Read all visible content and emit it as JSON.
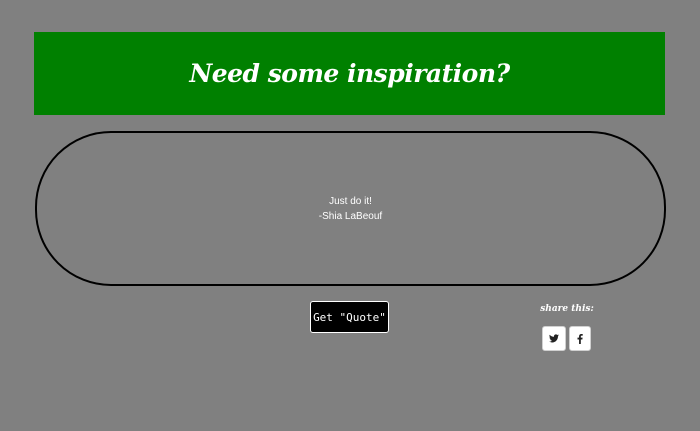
{
  "header": {
    "title": "Need some inspiration?"
  },
  "quote": {
    "text": "Just do it!",
    "author": "-Shia LaBeouf"
  },
  "actions": {
    "get_quote_label": "Get \"Quote\""
  },
  "share": {
    "label": "share this:",
    "buttons": [
      {
        "network": "twitter",
        "icon": "twitter-icon"
      },
      {
        "network": "facebook",
        "icon": "facebook-icon"
      }
    ]
  },
  "colors": {
    "background": "#808080",
    "banner": "#008000",
    "button": "#000000",
    "text": "#ffffff"
  }
}
